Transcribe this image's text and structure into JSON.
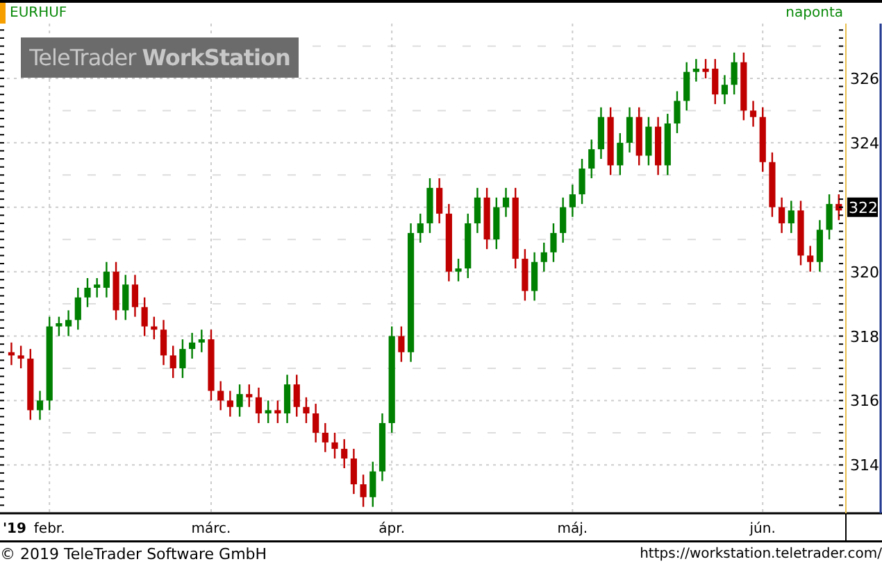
{
  "chart_header": {
    "interval": "naponta"
  },
  "logo": "TeleTrader **WorkStation**",
  "price_marker": "322",
  "year_label": "'19",
  "chart_data": {
    "type": "candlestick",
    "title": "EURHUF",
    "ylim": [
      312.5,
      327.7
    ],
    "yticks": [
      314,
      316,
      318,
      320,
      322,
      324,
      326
    ],
    "grid": true,
    "categories": [
      null,
      null,
      null,
      null,
      "febr.",
      null,
      null,
      null,
      null,
      null,
      null,
      null,
      null,
      null,
      null,
      null,
      null,
      null,
      null,
      null,
      null,
      "márc.",
      null,
      null,
      null,
      null,
      null,
      null,
      null,
      null,
      null,
      null,
      null,
      null,
      null,
      null,
      null,
      null,
      null,
      null,
      "ápr.",
      null,
      null,
      null,
      null,
      null,
      null,
      null,
      null,
      null,
      null,
      null,
      null,
      null,
      null,
      null,
      null,
      null,
      null,
      "máj.",
      null,
      null,
      null,
      null,
      null,
      null,
      null,
      null,
      null,
      null,
      null,
      null,
      null,
      null,
      null,
      null,
      null,
      null,
      null,
      "jún.",
      null,
      null,
      null,
      null,
      null,
      null,
      null,
      null
    ],
    "ohlc": [
      [
        317.5,
        317.8,
        317.1,
        317.4
      ],
      [
        317.4,
        317.7,
        317.0,
        317.3
      ],
      [
        317.3,
        317.6,
        315.4,
        315.7
      ],
      [
        315.7,
        316.3,
        315.4,
        316
      ],
      [
        316,
        318.6,
        315.7,
        318.3
      ],
      [
        318.3,
        318.6,
        318.0,
        318.4
      ],
      [
        318.3,
        318.8,
        318.0,
        318.5
      ],
      [
        318.5,
        319.5,
        318.2,
        319.2
      ],
      [
        319.2,
        319.8,
        318.9,
        319.5
      ],
      [
        319.5,
        319.8,
        319.2,
        319.6
      ],
      [
        319.5,
        320.3,
        319.2,
        320
      ],
      [
        320,
        320.3,
        318.5,
        318.8
      ],
      [
        318.8,
        319.9,
        318.5,
        319.6
      ],
      [
        319.6,
        319.9,
        318.6,
        318.9
      ],
      [
        318.9,
        319.2,
        318.0,
        318.3
      ],
      [
        318.3,
        318.6,
        317.9,
        318.2
      ],
      [
        318.2,
        318.5,
        317.1,
        317.4
      ],
      [
        317.4,
        317.7,
        316.7,
        317
      ],
      [
        317,
        317.9,
        316.7,
        317.6
      ],
      [
        317.6,
        318.1,
        317.3,
        317.8
      ],
      [
        317.8,
        318.2,
        317.5,
        317.9
      ],
      [
        317.9,
        318.2,
        316.0,
        316.3
      ],
      [
        316.3,
        316.6,
        315.7,
        316
      ],
      [
        316,
        316.3,
        315.5,
        315.8
      ],
      [
        315.8,
        316.5,
        315.5,
        316.2
      ],
      [
        316.2,
        316.5,
        315.8,
        316.1
      ],
      [
        316.1,
        316.4,
        315.3,
        315.6
      ],
      [
        315.6,
        316.0,
        315.3,
        315.7
      ],
      [
        315.7,
        316.0,
        315.3,
        315.6
      ],
      [
        315.6,
        316.8,
        315.3,
        316.5
      ],
      [
        316.5,
        316.8,
        315.5,
        315.8
      ],
      [
        315.8,
        316.1,
        315.3,
        315.6
      ],
      [
        315.6,
        315.9,
        314.7,
        315
      ],
      [
        315,
        315.3,
        314.4,
        314.7
      ],
      [
        314.7,
        315.0,
        314.2,
        314.5
      ],
      [
        314.5,
        314.8,
        313.9,
        314.2
      ],
      [
        314.2,
        314.5,
        313.1,
        313.4
      ],
      [
        313.4,
        313.7,
        312.7,
        313
      ],
      [
        313,
        314.1,
        312.7,
        313.8
      ],
      [
        313.8,
        315.6,
        313.5,
        315.3
      ],
      [
        315.3,
        318.3,
        315.0,
        318
      ],
      [
        318,
        318.3,
        317.2,
        317.5
      ],
      [
        317.5,
        321.5,
        317.2,
        321.2
      ],
      [
        321.2,
        321.8,
        320.9,
        321.5
      ],
      [
        321.5,
        322.9,
        321.2,
        322.6
      ],
      [
        322.6,
        322.9,
        321.5,
        321.8
      ],
      [
        321.8,
        322.1,
        319.7,
        320
      ],
      [
        320,
        320.4,
        319.7,
        320.1
      ],
      [
        320.1,
        321.8,
        319.8,
        321.5
      ],
      [
        321.5,
        322.6,
        321.2,
        322.3
      ],
      [
        322.3,
        322.6,
        320.7,
        321
      ],
      [
        321,
        322.3,
        320.7,
        322
      ],
      [
        322,
        322.6,
        321.7,
        322.3
      ],
      [
        322.3,
        322.6,
        320.1,
        320.4
      ],
      [
        320.4,
        320.7,
        319.1,
        319.4
      ],
      [
        319.4,
        320.6,
        319.1,
        320.3
      ],
      [
        320.3,
        320.9,
        320.0,
        320.6
      ],
      [
        320.6,
        321.5,
        320.3,
        321.2
      ],
      [
        321.2,
        322.3,
        320.9,
        322
      ],
      [
        322,
        322.7,
        321.7,
        322.4
      ],
      [
        322.4,
        323.5,
        322.1,
        323.2
      ],
      [
        323.2,
        324.1,
        322.9,
        323.8
      ],
      [
        323.8,
        325.1,
        323.5,
        324.8
      ],
      [
        324.8,
        325.1,
        323.0,
        323.3
      ],
      [
        323.3,
        324.3,
        323.0,
        324
      ],
      [
        324,
        325.1,
        323.7,
        324.8
      ],
      [
        324.8,
        325.1,
        323.3,
        323.6
      ],
      [
        323.6,
        324.8,
        323.3,
        324.5
      ],
      [
        324.5,
        324.8,
        323.0,
        323.3
      ],
      [
        323.3,
        324.9,
        323.0,
        324.6
      ],
      [
        324.6,
        325.6,
        324.3,
        325.3
      ],
      [
        325.3,
        326.5,
        325.0,
        326.2
      ],
      [
        326.2,
        326.6,
        325.9,
        326.3
      ],
      [
        326.3,
        326.6,
        326.0,
        326.2
      ],
      [
        326.3,
        326.6,
        325.2,
        325.5
      ],
      [
        325.5,
        326.1,
        325.2,
        325.8
      ],
      [
        325.8,
        326.8,
        325.5,
        326.5
      ],
      [
        326.5,
        326.8,
        324.7,
        325
      ],
      [
        325,
        325.3,
        324.5,
        324.8
      ],
      [
        324.8,
        325.1,
        323.1,
        323.4
      ],
      [
        323.4,
        323.7,
        321.7,
        322
      ],
      [
        322,
        322.3,
        321.2,
        321.5
      ],
      [
        321.5,
        322.2,
        321.2,
        321.9
      ],
      [
        321.9,
        322.2,
        320.2,
        320.5
      ],
      [
        320.5,
        320.8,
        320.0,
        320.3
      ],
      [
        320.3,
        321.6,
        320.0,
        321.3
      ],
      [
        321.3,
        322.4,
        321.0,
        322.1
      ],
      [
        322.1,
        322.4,
        321.6,
        321.9
      ]
    ]
  },
  "footer": {
    "copyright": "© 2019 TeleTrader Software GmbH",
    "url": "https://workstation.teletrader.com/"
  }
}
